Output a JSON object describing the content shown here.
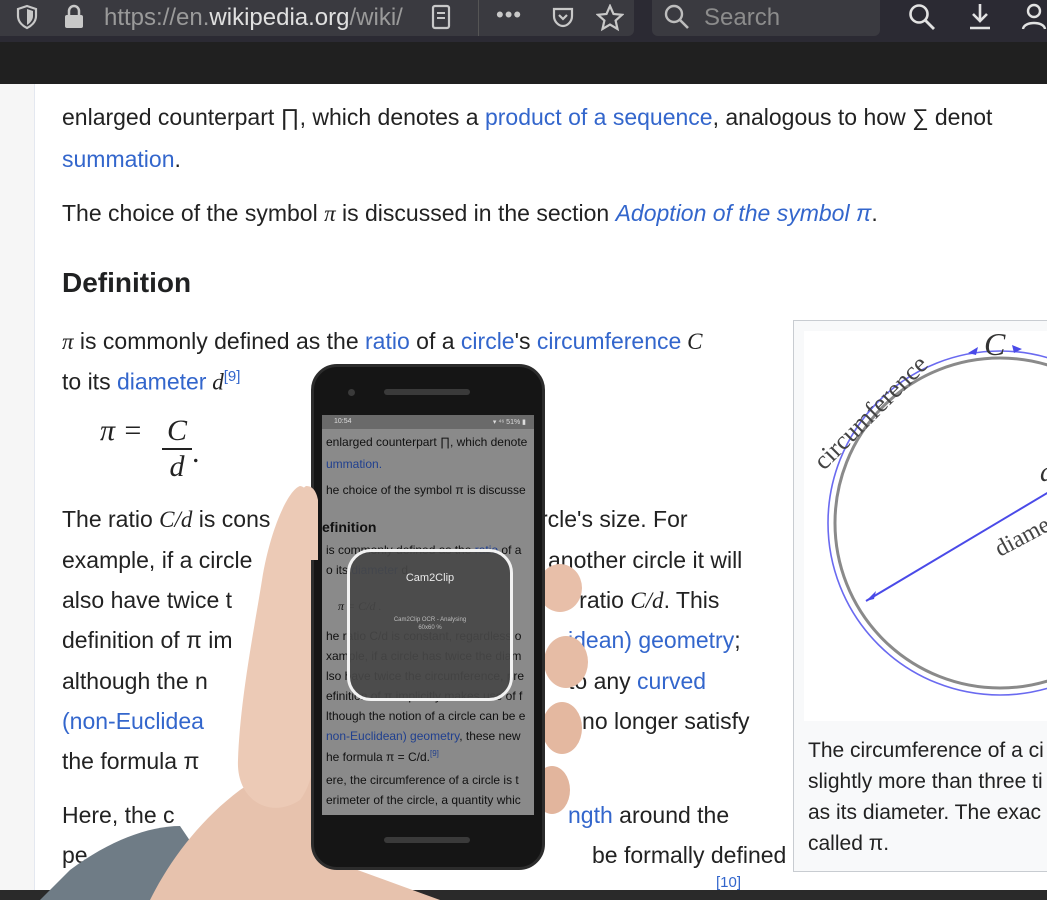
{
  "browser": {
    "url_prefix": "https://en.",
    "url_domain": "wikipedia.org",
    "url_suffix": "/wiki/",
    "search_placeholder": "Search",
    "icons": [
      "shield-icon",
      "lock-icon",
      "reader-view-icon",
      "more-icon",
      "pocket-icon",
      "star-icon",
      "search-icon",
      "download-icon",
      "account-icon"
    ]
  },
  "article": {
    "line1_a": "enlarged counterpart ∏, which denotes a ",
    "line1_link": "product of a sequence",
    "line1_b": ", analogous to how ∑ denot",
    "line2_link": "summation",
    "line2_b": ".",
    "line3_a": "The choice of the symbol ",
    "line3_pi": "π",
    "line3_b": " is discussed in the section ",
    "line3_link": "Adoption of the symbol π",
    "line3_c": ".",
    "heading": "Definition",
    "def1_pi": "π",
    "def1_a": " is commonly defined as the ",
    "def1_link1": "ratio",
    "def1_b": " of a ",
    "def1_link2": "circle",
    "def1_c": "'s ",
    "def1_link3": "circumference",
    "def1_C": " C",
    "def2_a": "to its ",
    "def2_link": "diameter",
    "def2_d": " d",
    "def2_sup": "[9]",
    "formula_lhs": "π =",
    "formula_num": "C",
    "formula_den": "d",
    "formula_dot": ".",
    "ratio_line_a": "The ratio ",
    "ratio_line_cd": "C/d",
    "ratio_line_b": " is cons",
    "ratio_line_c": "rcle's size. For",
    "ex_line_a": "example, if a circle",
    "ex_line_b": "another circle it will",
    "also_line_a": "also have twice t",
    "also_line_b": "e ratio ",
    "also_line_cd": "C/d",
    "also_line_c": ". This",
    "defn_line_a": "definition of π im",
    "defn_line_link": "idean) geometry",
    "defn_line_b": ";",
    "alth_line_a": "although the n",
    "alth_line_b": "to any ",
    "alth_line_link": "curved",
    "noneu_link": "(non-Euclidea",
    "noneu_b": ") no longer satisfy",
    "formula_line": "the formula π",
    "here_line_a": "Here, the c",
    "here_line_link": "ngth",
    "here_line_b": " around the",
    "peri_line_a": "pe",
    "peri_line_b": "be formally defined",
    "bottom_sup": "[10]"
  },
  "figure": {
    "label_circumference": "circumference",
    "label_C": "C",
    "label_diameter": "diame",
    "label_d": "d",
    "caption_l1": "The circumference of a ci",
    "caption_l2": "slightly more than three ti",
    "caption_l3": "as its diameter. The exac",
    "caption_l4": "called π."
  },
  "phone": {
    "status_time": "10:54",
    "status_right": "▾ ⁴⁶ 51% ▮",
    "s1": "enlarged counterpart ∏, which denote",
    "s2_link": "ummation.",
    "s3": "he choice of the symbol π is discusse",
    "heading": "efinition",
    "s4_a": "is commonly defined as the ",
    "s4_link": "ratio",
    "s4_b": " of a",
    "s5_a": "o its ",
    "s5_link": "diameter",
    "s5_b": " d.",
    "s6": "π =  C/d .",
    "s7": "he ratio C/d is constant, regardless o",
    "s8": "xample, if a circle has twice the diam",
    "s9": "lso have twice the circumference, pre",
    "s10": "efinition of π implicitly makes use of f",
    "s11": "lthough the notion of a circle can be e",
    "s12_link": "non-Euclidean) geometry",
    "s12_b": ", these new",
    "s13": "he formula π = C/d.",
    "s13_sup": "[9]",
    "s14": "ere, the circumference of a circle is t",
    "s15": "erimeter of the circle, a quantity whic",
    "popup_title": "Cam2Clip",
    "popup_status_1": "Cam2Clip OCR - Analysing",
    "popup_status_2": "60x60 %"
  }
}
